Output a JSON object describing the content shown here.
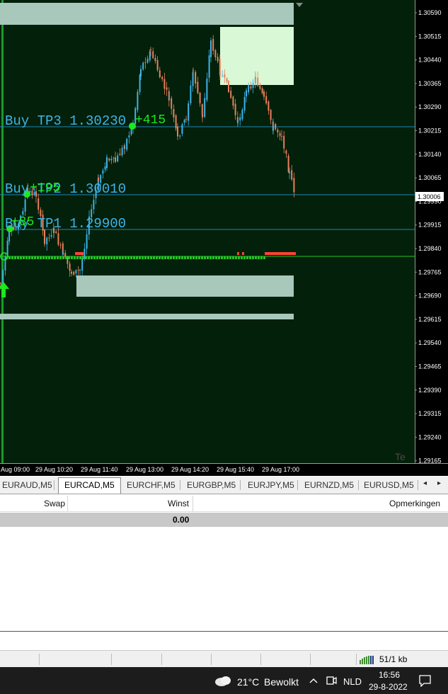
{
  "chart": {
    "price_scale": [
      "1.30590",
      "1.30515",
      "1.30440",
      "1.30365",
      "1.30290",
      "1.30215",
      "1.30140",
      "1.30065",
      "1.29990",
      "1.29915",
      "1.29840",
      "1.29765",
      "1.29690",
      "1.29615",
      "1.29540",
      "1.29465",
      "1.29390",
      "1.29315",
      "1.29240",
      "1.29165"
    ],
    "current_price": "1.30006",
    "time_labels": [
      "Aug 09:00",
      "29 Aug 10:20",
      "29 Aug 11:40",
      "29 Aug 13:00",
      "29 Aug 14:20",
      "29 Aug 15:40",
      "29 Aug 17:00"
    ],
    "tp3_label": "Buy  TP3  1.30230",
    "tp3_pips": "+415",
    "tp2_label": "Buy  TP2  1.30010",
    "tp2_pips": "+195",
    "tp1_label": "Buy  TP1  1.29900",
    "tp1_pips": "+85",
    "corner_text": "Te",
    "colors": {
      "background": "#03200a",
      "bull_candle": "#3fb3e8",
      "bear_candle": "#e8805d",
      "level_line": "#1e86b7",
      "entry_line": "#26c626",
      "signal_green": "#1ee81e",
      "zone": "#a9c8bc",
      "zone_light": "#d9f8d6",
      "sell_marker": "#ff4433"
    }
  },
  "tabs": [
    "EURAUD,M5",
    "EURCAD,M5",
    "EURCHF,M5",
    "EURGBP,M5",
    "EURJPY,M5",
    "EURNZD,M5",
    "EURUSD,M5"
  ],
  "active_tab": "EURCAD,M5",
  "tab_scroll": {
    "left": "◂",
    "right": "▸"
  },
  "terminal": {
    "col_swap": "Swap",
    "col_winst": "Winst",
    "col_opmerkingen": "Opmerkingen",
    "total_winst": "0.00"
  },
  "status": {
    "network": "51/1 kb"
  },
  "taskbar": {
    "weather_temp": "21°C",
    "weather_desc": "Bewolkt",
    "lang": "NLD",
    "time": "16:56",
    "date": "29-8-2022"
  }
}
